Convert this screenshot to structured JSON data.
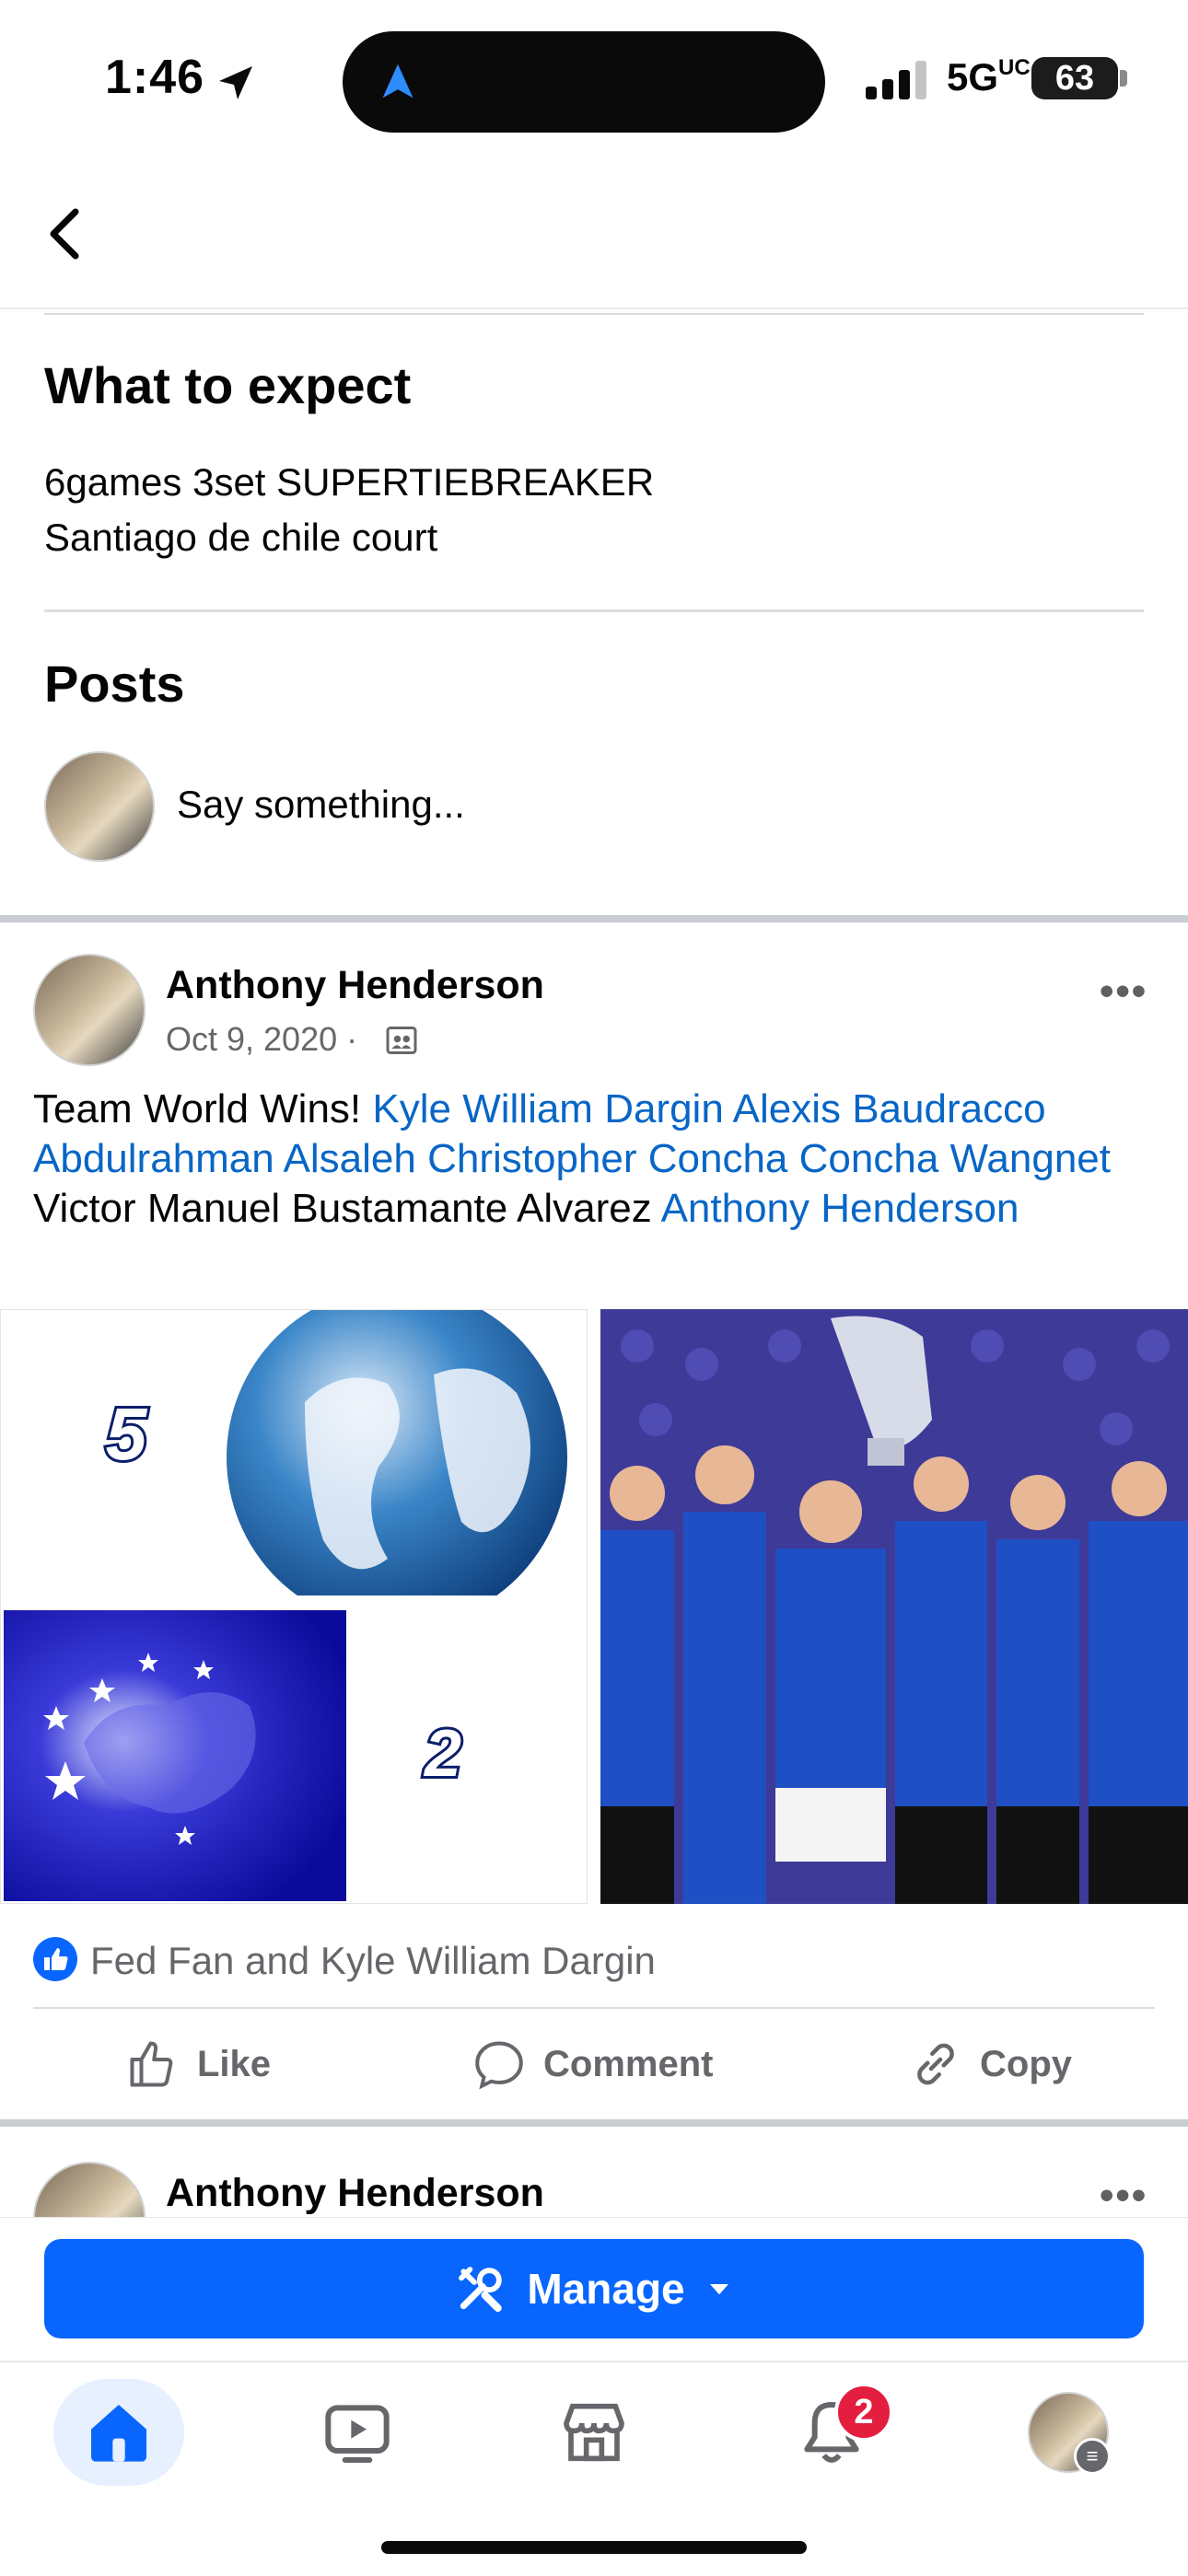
{
  "status_bar": {
    "time": "1:46",
    "network": "5G",
    "network_sub": "UC",
    "battery": "63"
  },
  "event": {
    "expect_title": "What to expect",
    "expect_line1": "6games 3set SUPERTIEBREAKER",
    "expect_line2": "Santiago de chile court",
    "posts_title": "Posts",
    "composer_placeholder": "Say something..."
  },
  "post": {
    "author": "Anthony Henderson",
    "date": "Oct 9, 2020 ·",
    "text_prefix": "Team World Wins!",
    "tag1": "Kyle William Dargin",
    "tag2": "Alexis Baudracco",
    "tag3": "Abdulrahman Alsaleh",
    "tag4": "Christopher Concha",
    "tag5": "Concha Wangnet",
    "plain_name": "Victor Manuel Bustamante Alvarez",
    "tag6": "Anthony Henderson",
    "score_world": "5",
    "score_europe": "2",
    "reactions": "Fed Fan and Kyle William Dargin",
    "actions": {
      "like": "Like",
      "comment": "Comment",
      "copy": "Copy"
    }
  },
  "next_post": {
    "author": "Anthony Henderson"
  },
  "manage_button": "Manage",
  "tabbar": {
    "notification_count": "2"
  },
  "colors": {
    "brand_blue": "#0866ff",
    "link_blue": "#0866c6",
    "badge_red": "#e41e3f"
  },
  "icons": [
    "location-arrow-icon",
    "signal-icon",
    "battery-icon",
    "back-chevron-icon",
    "audience-icon",
    "more-icon",
    "like-reaction-icon",
    "like-icon",
    "comment-icon",
    "copy-link-icon",
    "tools-icon",
    "caret-down-icon",
    "home-icon",
    "video-icon",
    "marketplace-icon",
    "bell-icon",
    "profile-avatar"
  ]
}
